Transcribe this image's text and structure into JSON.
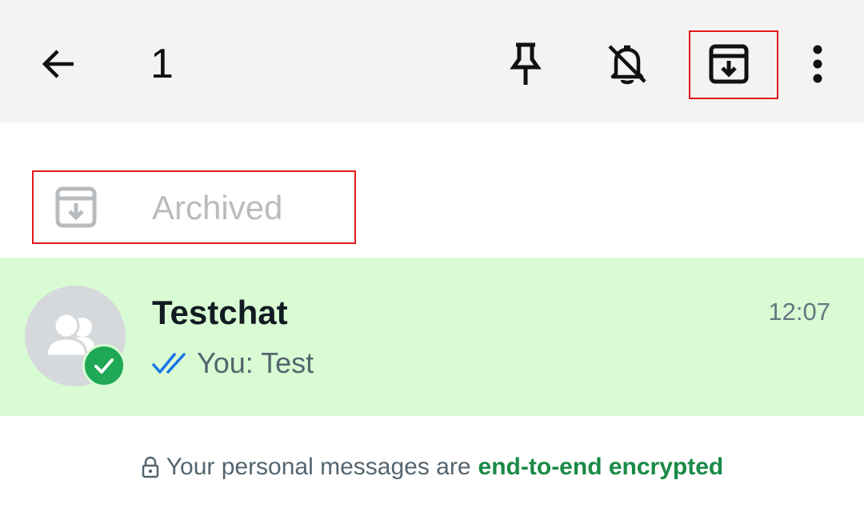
{
  "header": {
    "selected_count": "1",
    "actions": [
      "pin-icon",
      "mute-icon",
      "archive-icon",
      "more-vert-icon"
    ]
  },
  "archived": {
    "label": "Archived"
  },
  "chat": {
    "name": "Testchat",
    "time": "12:07",
    "preview": "You: Test",
    "read_status": "read"
  },
  "footer": {
    "prefix": "Your personal messages are",
    "link": "end-to-end encrypted"
  },
  "colors": {
    "accent": "#1fa855",
    "selected_row": "#d9fbd3",
    "link": "#1a8a47",
    "highlight": "#e0191b",
    "read_ticks": "#1a73e8"
  }
}
